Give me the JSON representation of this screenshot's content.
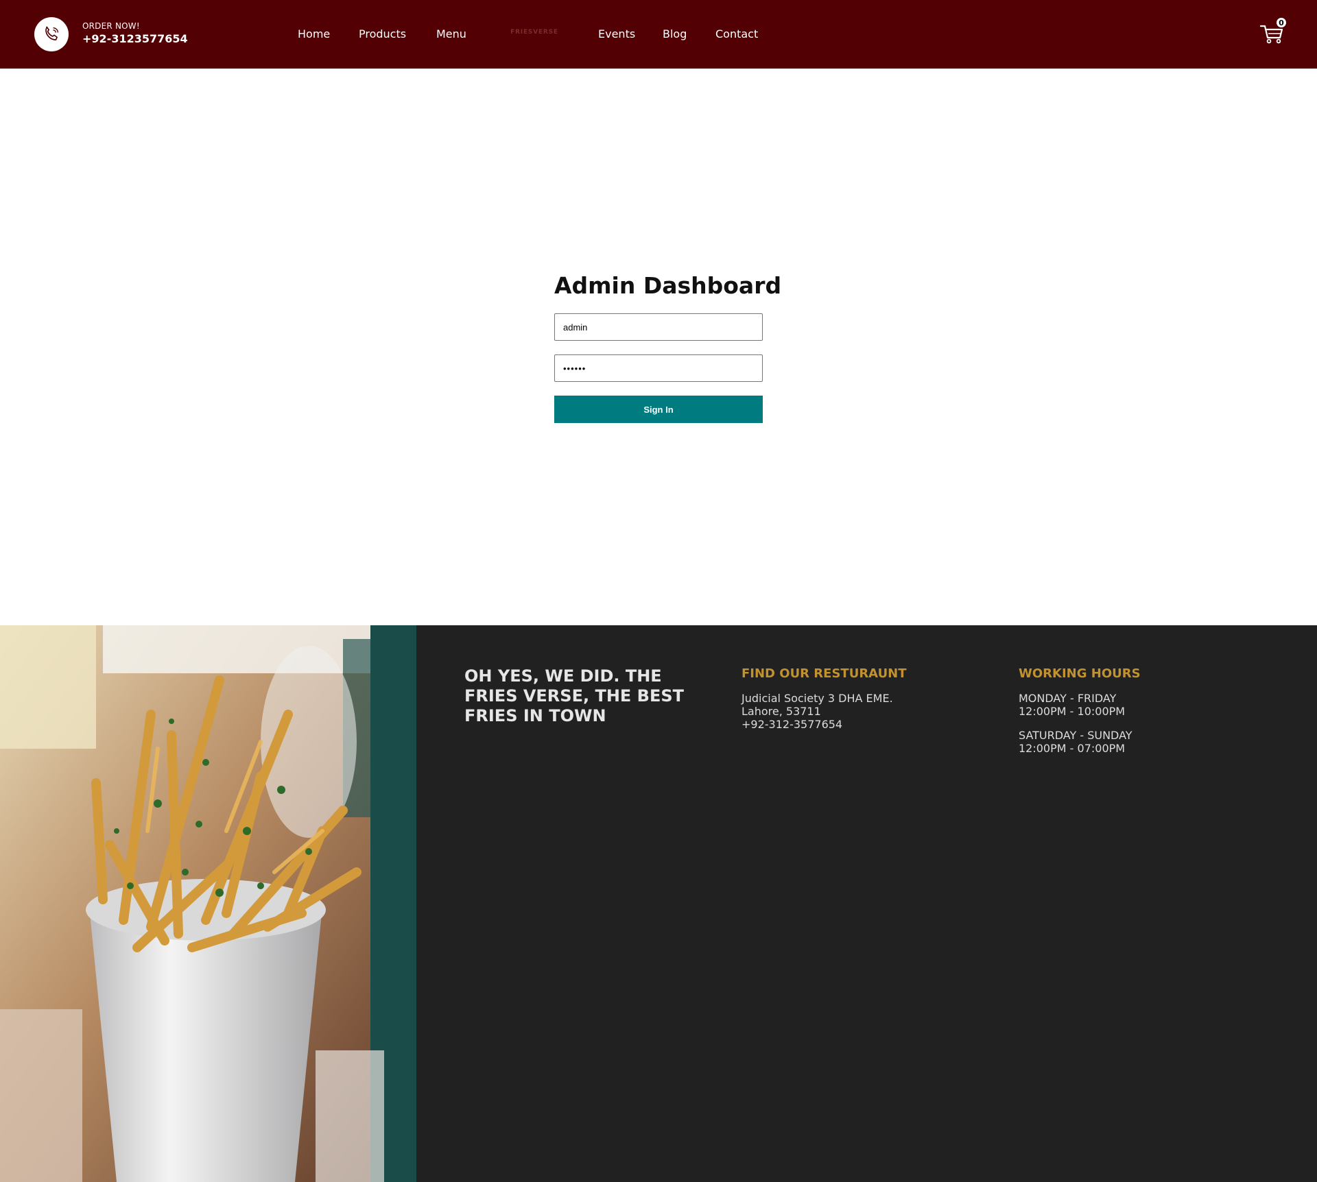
{
  "header": {
    "order_label": "ORDER NOW!",
    "order_phone": "+92-3123577654",
    "nav": {
      "home": "Home",
      "products": "Products",
      "menu": "Menu",
      "logo_text": "FRIESVERSE",
      "events": "Events",
      "blog": "Blog",
      "contact": "Contact"
    },
    "cart_count": "0",
    "icons": {
      "phone": "phone-icon",
      "cart": "cart-icon"
    }
  },
  "login": {
    "title": "Admin Dashboard",
    "username_value": "admin",
    "password_value": "••••••",
    "signin_label": "Sign In"
  },
  "footer": {
    "slogan": "OH YES, WE DID. THE FRIES VERSE, THE BEST FRIES IN TOWN",
    "find": {
      "heading": "FIND OUR RESTURAUNT",
      "address_line1": "Judicial Society 3 DHA EME.",
      "address_line2": "Lahore, 53711",
      "phone": "+92-312-3577654"
    },
    "hours": {
      "heading": "WORKING HOURS",
      "weekday_label": "MONDAY - FRIDAY",
      "weekday_time": "12:00PM - 10:00PM",
      "weekend_label": "SATURDAY - SUNDAY",
      "weekend_time": "12:00PM - 07:00PM"
    }
  },
  "colors": {
    "header_bg": "#520003",
    "button_bg": "#007c80",
    "footer_bg": "#212121",
    "footer_accent": "#c1922f"
  }
}
